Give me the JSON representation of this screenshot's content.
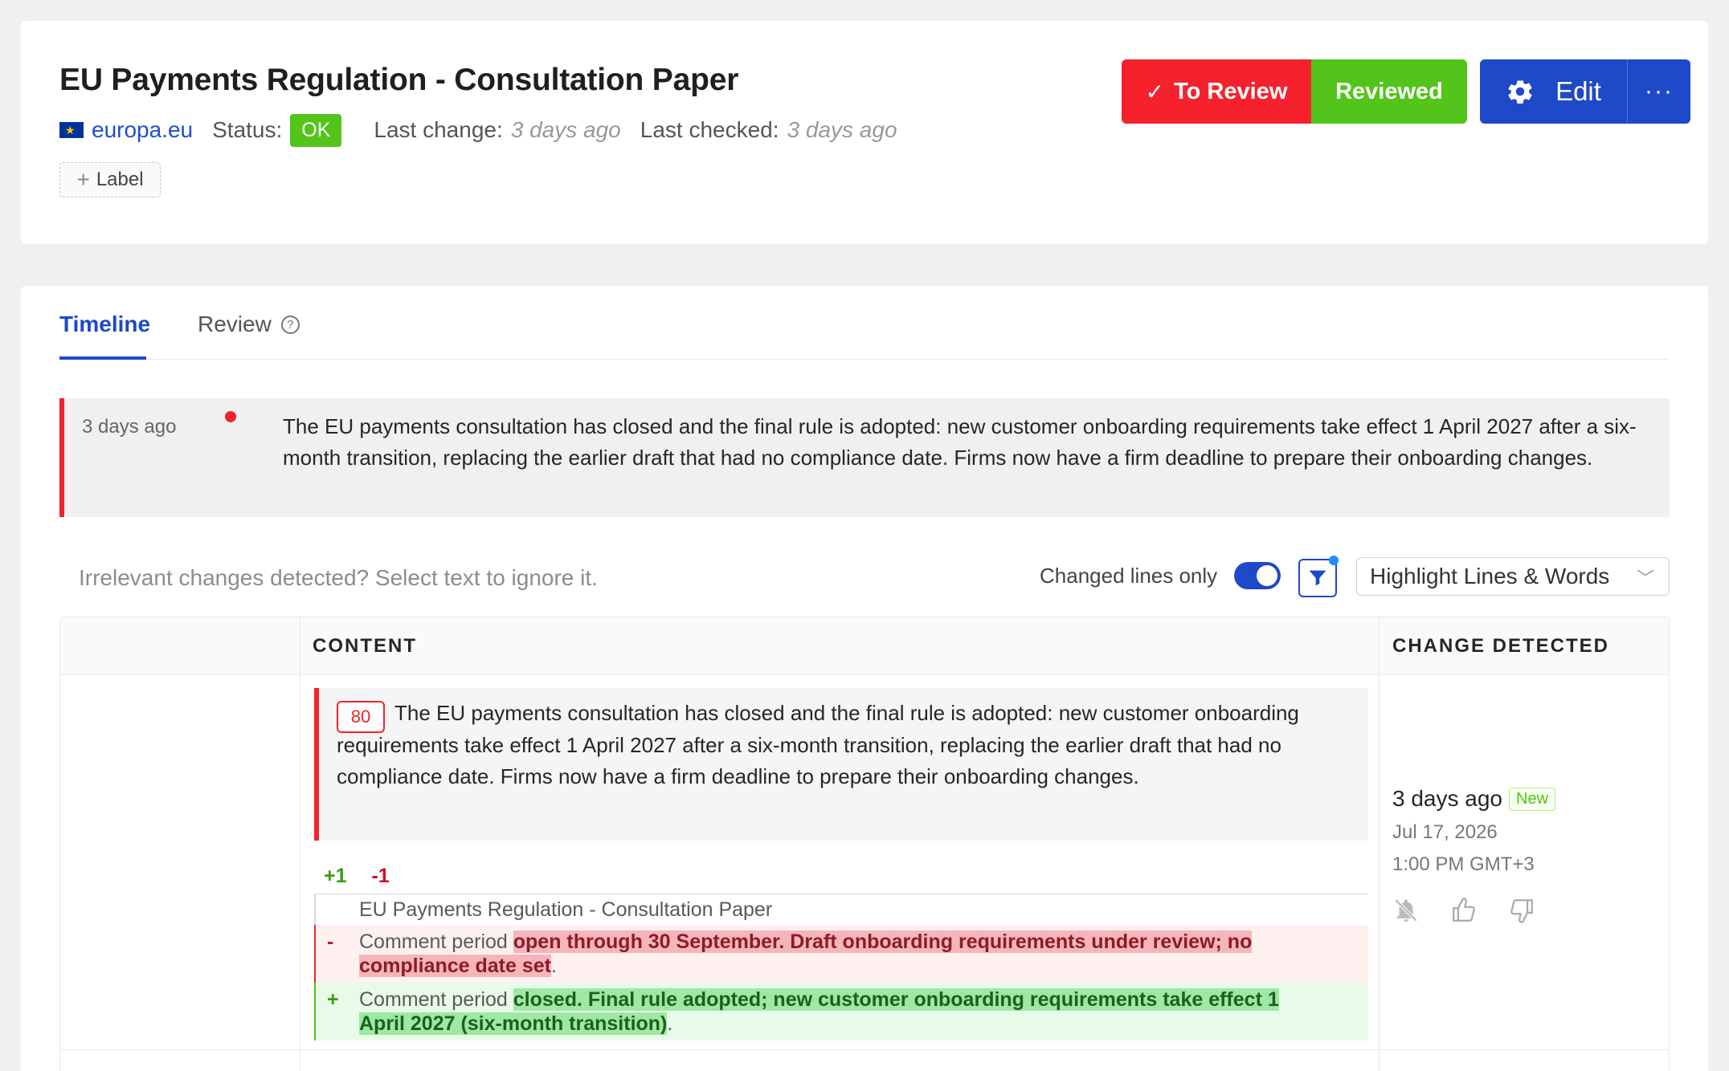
{
  "header": {
    "title": "EU Payments Regulation - Consultation Paper",
    "source_link": "europa.eu",
    "status_label": "Status:",
    "status_value": "OK",
    "last_change_label": "Last change:",
    "last_change_value": "3 days ago",
    "last_checked_label": "Last checked:",
    "last_checked_value": "3 days ago",
    "add_label_text": "Label",
    "colors": {
      "accent": "#1e49c8",
      "danger": "#f5222d",
      "success": "#52c41a"
    }
  },
  "actions": {
    "to_review_label": "To Review",
    "reviewed_label": "Reviewed",
    "edit_label": "Edit",
    "more_label": "···"
  },
  "tabs": {
    "timeline": "Timeline",
    "review": "Review",
    "review_help": "?"
  },
  "timeline_item": {
    "time": "3 days ago",
    "text": "The EU payments consultation has closed and the final rule is adopted: new customer onboarding requirements take effect 1 April 2027 after a six-month transition, replacing the earlier draft that had no compliance date. Firms now have a firm deadline to prepare their onboarding changes."
  },
  "controls": {
    "hint": "Irrelevant changes detected? Select text to ignore it.",
    "changed_lines_only_label": "Changed lines only",
    "changed_lines_only_on": true,
    "highlight_mode": "Highlight Lines & Words"
  },
  "table": {
    "col_content": "CONTENT",
    "col_change": "CHANGE DETECTED",
    "row": {
      "score": "80",
      "summary": "The EU payments consultation has closed and the final rule is adopted: new customer onboarding requirements take effect 1 April 2027 after a six-month transition, replacing the earlier draft that had no compliance date. Firms now have a firm deadline to prepare their onboarding changes.",
      "added_count": "+1",
      "removed_count": "-1",
      "diff_title": "EU Payments Regulation - Consultation Paper",
      "del_sign": "-",
      "del_prefix": "Comment period",
      "del_words": "open through 30 September. Draft onboarding requirements under review; no compliance date set",
      "del_suffix": ".",
      "add_sign": "+",
      "add_prefix": "Comment period",
      "add_words": "closed. Final rule adopted; new customer onboarding requirements take effect 1 April 2027 (six-month transition)",
      "add_suffix": ".",
      "change_ago": "3 days ago",
      "new_badge": "New",
      "change_date": "Jul 17, 2026",
      "change_time": "1:00 PM GMT+3"
    }
  },
  "icons": [
    "eu-flag-icon",
    "plus-icon",
    "check-icon",
    "gear-icon",
    "more-icon",
    "help-icon",
    "filter-icon",
    "chevron-down-icon",
    "mute-bell-icon",
    "thumbs-up-icon",
    "thumbs-down-icon"
  ]
}
